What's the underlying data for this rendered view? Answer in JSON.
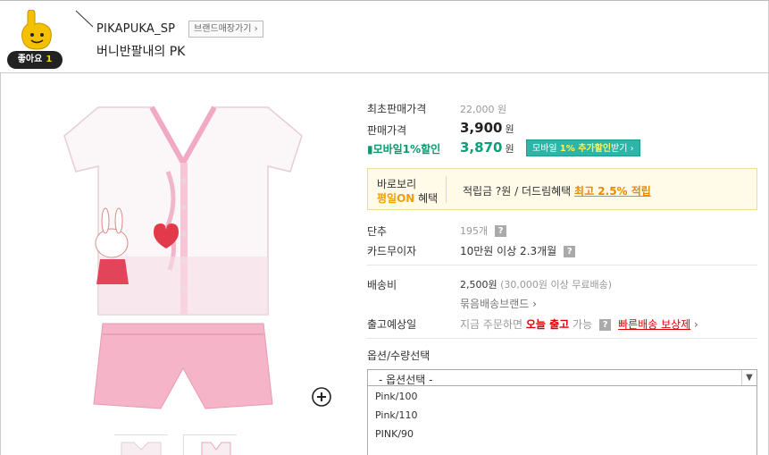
{
  "header": {
    "like_label": "좋아요",
    "like_count": "1",
    "brand_name": "PIKAPUKA_SP",
    "brand_button": "브랜드매장가기 ›",
    "product_title": "버니반팔내의 PK"
  },
  "price": {
    "lowest_label": "최초판매가격",
    "lowest_value": "22,000 원",
    "sale_label": "판매가격",
    "sale_value": "3,900",
    "sale_unit": "원",
    "mobile_label": "▮모바일1%할인",
    "mobile_value": "3,870",
    "mobile_unit": "원",
    "mobile_button_pre": "모바일 ",
    "mobile_button_hl": "1% 추가할인",
    "mobile_button_post": "받기 ›"
  },
  "benefit": {
    "line1": "바로보리",
    "line2_on": "평일ON",
    "line2_rest": " 혜택",
    "text_pre": "적립금 ?원 / 더드림혜택 ",
    "text_hl": "최고 2.5% 적립"
  },
  "info": {
    "stock_label": "단추",
    "stock_value": "195개",
    "card_label": "카드무이자",
    "card_value": "10만원 이상 2.3개월",
    "ship_label": "배송비",
    "ship_value": "2,500원",
    "ship_note": " (30,000원 이상 무료배송)",
    "bundle_link": "묶음배송브랜드",
    "bundle_arrow": " ›",
    "release_label": "출고예상일",
    "release_pre": "지금 주문하면 ",
    "release_bold": "오늘 출고",
    "release_post": " 가능",
    "fast_link": "빠른배송 보상제",
    "fast_arrow": " ›",
    "question": "?"
  },
  "options": {
    "label": "옵션/수량선택",
    "selected": "- 옵션선택 -",
    "items": [
      "Pink/100",
      "Pink/110",
      "PINK/90"
    ]
  },
  "colors": {
    "accent_green": "#0aa07a",
    "mobile_btn": "#2db6a8",
    "highlight_orange": "#e88a00",
    "red": "#dd0000"
  }
}
